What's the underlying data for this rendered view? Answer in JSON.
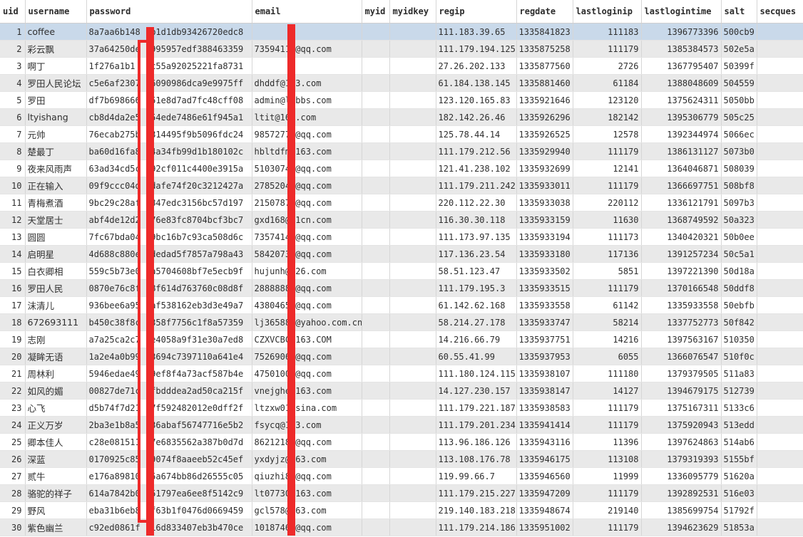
{
  "columns": [
    "uid",
    "username",
    "password",
    "email",
    "myid",
    "myidkey",
    "regip",
    "regdate",
    "lastloginip",
    "lastlogintime",
    "salt",
    "secques"
  ],
  "rows": [
    {
      "uid": "1",
      "username": "coffee",
      "password": "8a7aa6b148  b1d1db93426720edc8",
      "email": "",
      "myid": "",
      "myidkey": "",
      "regip": "111.183.39.65",
      "regdate": "1335841823",
      "lastloginip": "111183",
      "lastlogintime": "1396773396",
      "salt": "500cb9",
      "secques": ""
    },
    {
      "uid": "2",
      "username": "彩云飘",
      "password": "37a64250de  995957edf388463359",
      "email": "73594115@qq.com",
      "myid": "",
      "myidkey": "",
      "regip": "111.179.194.125",
      "regdate": "1335875258",
      "lastloginip": "111179",
      "lastlogintime": "1385384573",
      "salt": "502e5a",
      "secques": ""
    },
    {
      "uid": "3",
      "username": "啊丁",
      "password": "1f276a1b1   c55a92025221fa8731",
      "email": "",
      "myid": "",
      "myidkey": "",
      "regip": "27.26.202.133",
      "regdate": "1335877560",
      "lastloginip": "2726",
      "lastlogintime": "1367795407",
      "salt": "50399f",
      "secques": ""
    },
    {
      "uid": "4",
      "username": "罗田人民论坛",
      "password": "c5e6af2307  6090986dca9e9975ff",
      "email": "dhddf@163.com",
      "myid": "",
      "myidkey": "",
      "regip": "61.184.138.145",
      "regdate": "1335881460",
      "lastloginip": "61184",
      "lastlogintime": "1388048609",
      "salt": "504559",
      "secques": ""
    },
    {
      "uid": "5",
      "username": "罗田",
      "password": "df7b698666  51e8d7ad7fc48cff08",
      "email": "admin@lrbbs.com",
      "myid": "",
      "myidkey": "",
      "regip": "123.120.165.83",
      "regdate": "1335921646",
      "lastloginip": "123120",
      "lastlogintime": "1375624311",
      "salt": "5050bb",
      "secques": ""
    },
    {
      "uid": "6",
      "username": "ltyishang",
      "password": "cb8d4da2e5  54ede7486e61f945a1",
      "email": "ltit@163.com",
      "myid": "",
      "myidkey": "",
      "regip": "182.142.26.46",
      "regdate": "1335926296",
      "lastloginip": "182142",
      "lastlogintime": "1395306779",
      "salt": "505c25",
      "secques": ""
    },
    {
      "uid": "7",
      "username": "元帅",
      "password": "76ecab275b  314495f9b5096fdc24",
      "email": "98572776@qq.com",
      "myid": "",
      "myidkey": "",
      "regip": "125.78.44.14",
      "regdate": "1335926525",
      "lastloginip": "12578",
      "lastlogintime": "1392344974",
      "salt": "5066ec",
      "secques": ""
    },
    {
      "uid": "8",
      "username": "楚最丁",
      "password": "ba60d16fa8  4a34fb99d1b180102c",
      "email": "hbltdfm@163.com",
      "myid": "",
      "myidkey": "",
      "regip": "111.179.212.56",
      "regdate": "1335929940",
      "lastloginip": "111179",
      "lastlogintime": "1386131127",
      "salt": "5073b0",
      "secques": ""
    },
    {
      "uid": "9",
      "username": "夜来风雨声",
      "password": "63ad34cd5c  92cf011c4400e3915a",
      "email": "51030748@qq.com",
      "myid": "",
      "myidkey": "",
      "regip": "121.41.238.102",
      "regdate": "1335932699",
      "lastloginip": "12141",
      "lastlogintime": "1364046871",
      "salt": "508039",
      "secques": ""
    },
    {
      "uid": "10",
      "username": "正在输入",
      "password": "09f9ccc04d  dafe74f20c3212427a",
      "email": "27852045@qq.com",
      "myid": "",
      "myidkey": "",
      "regip": "111.179.211.242",
      "regdate": "1335933011",
      "lastloginip": "111179",
      "lastlogintime": "1366697751",
      "salt": "508bf8",
      "secques": ""
    },
    {
      "uid": "11",
      "username": "青梅煮酒",
      "password": "9bc29c28af  847edc3156bc57d197",
      "email": "21507874@qq.com",
      "myid": "",
      "myidkey": "",
      "regip": "220.112.22.30",
      "regdate": "1335933038",
      "lastloginip": "220112",
      "lastlogintime": "1336121791",
      "salt": "5097b3",
      "secques": ""
    },
    {
      "uid": "12",
      "username": "天堂居士",
      "password": "abf4de12d2  76e83fc8704bcf3bc7",
      "email": "gxd168@21cn.com",
      "myid": "",
      "myidkey": "",
      "regip": "116.30.30.118",
      "regdate": "1335933159",
      "lastloginip": "11630",
      "lastlogintime": "1368749592",
      "salt": "50a323",
      "secques": ""
    },
    {
      "uid": "13",
      "username": "圆圆",
      "password": "7fc67bda04  9bc16b7c93ca508d6c",
      "email": "73574145@qq.com",
      "myid": "",
      "myidkey": "",
      "regip": "111.173.97.135",
      "regdate": "1335933194",
      "lastloginip": "111173",
      "lastlogintime": "1340420321",
      "salt": "50b0ee",
      "secques": ""
    },
    {
      "uid": "14",
      "username": "启明星",
      "password": "4d688c880e  dedad5f7857a798a43",
      "email": "58420737@qq.com",
      "myid": "",
      "myidkey": "",
      "regip": "117.136.23.54",
      "regdate": "1335933180",
      "lastloginip": "117136",
      "lastlogintime": "1391257234",
      "salt": "50c5a1",
      "secques": ""
    },
    {
      "uid": "15",
      "username": "白衣卿相",
      "password": "559c5b73e0  a5704608bf7e5ecb9f",
      "email": "hujunh@126.com",
      "myid": "",
      "myidkey": "",
      "regip": "58.51.123.47",
      "regdate": "1335933502",
      "lastloginip": "5851",
      "lastlogintime": "1397221390",
      "salt": "50d18a",
      "secques": ""
    },
    {
      "uid": "16",
      "username": "罗田人民",
      "password": "0870e76c8f  8f614d763760c08d8f",
      "email": "28888888@qq.com",
      "myid": "",
      "myidkey": "",
      "regip": "111.179.195.3",
      "regdate": "1335933515",
      "lastloginip": "111179",
      "lastlogintime": "1370166548",
      "salt": "50ddf8",
      "secques": ""
    },
    {
      "uid": "17",
      "username": "沫清儿",
      "password": "936bee6a95  af538162eb3d3e49a7",
      "email": "43804650@qq.com",
      "myid": "",
      "myidkey": "",
      "regip": "61.142.62.168",
      "regdate": "1335933558",
      "lastloginip": "61142",
      "lastlogintime": "1335933558",
      "salt": "50ebfb",
      "secques": ""
    },
    {
      "uid": "18",
      "username": "672693111",
      "password": "b450c38f8c  358f7756c1f8a57359",
      "email": "lj365888@yahoo.com.cn",
      "myid": "",
      "myidkey": "",
      "regip": "58.214.27.178",
      "regdate": "1335933747",
      "lastloginip": "58214",
      "lastlogintime": "1337752773",
      "salt": "50f842",
      "secques": ""
    },
    {
      "uid": "19",
      "username": "志刚",
      "password": "a7a25ca2c7  e4058a9f31e30a7ed8",
      "email": "CZXVCBC@163.COM",
      "myid": "",
      "myidkey": "",
      "regip": "14.216.66.79",
      "regdate": "1335937751",
      "lastloginip": "14216",
      "lastlogintime": "1397563167",
      "salt": "510350",
      "secques": ""
    },
    {
      "uid": "20",
      "username": "凝眸无语",
      "password": "1a2e4a0b99  3694c7397110a641e4",
      "email": "75269066@qq.com",
      "myid": "",
      "myidkey": "",
      "regip": "60.55.41.99",
      "regdate": "1335937953",
      "lastloginip": "6055",
      "lastlogintime": "1366076547",
      "salt": "510f0c",
      "secques": ""
    },
    {
      "uid": "21",
      "username": "周林利",
      "password": "5946edae49  9ef8f4a73acf587b4e",
      "email": "47501004@qq.com",
      "myid": "",
      "myidkey": "",
      "regip": "111.180.124.115",
      "regdate": "1335938107",
      "lastloginip": "111180",
      "lastlogintime": "1379379505",
      "salt": "511a83",
      "secques": ""
    },
    {
      "uid": "22",
      "username": "如风的媚",
      "password": "00827de71c  fbdddea2ad50ca215f",
      "email": "vnejghe@163.com",
      "myid": "",
      "myidkey": "",
      "regip": "14.127.230.157",
      "regdate": "1335938147",
      "lastloginip": "14127",
      "lastlogintime": "1394679175",
      "salt": "512739",
      "secques": ""
    },
    {
      "uid": "23",
      "username": "心飞",
      "password": "d5b74f7d21  7f592482012e0dff2f",
      "email": "ltzxw01@sina.com",
      "myid": "",
      "myidkey": "",
      "regip": "111.179.221.187",
      "regdate": "1335938583",
      "lastloginip": "111179",
      "lastlogintime": "1375167311",
      "salt": "5133c6",
      "secques": ""
    },
    {
      "uid": "24",
      "username": "正义万岁",
      "password": "2ba3e1b8a5  36abaf56747716e5b2",
      "email": "fsycq@163.com",
      "myid": "",
      "myidkey": "",
      "regip": "111.179.201.234",
      "regdate": "1335941414",
      "lastloginip": "111179",
      "lastlogintime": "1375920943",
      "salt": "513edd",
      "secques": ""
    },
    {
      "uid": "25",
      "username": "卿本佳人",
      "password": "c28e081511  7e6835562a387b0d7d",
      "email": "86212188@qq.com",
      "myid": "",
      "myidkey": "",
      "regip": "113.96.186.126",
      "regdate": "1335943116",
      "lastloginip": "11396",
      "lastlogintime": "1397624863",
      "salt": "514ab6",
      "secques": ""
    },
    {
      "uid": "26",
      "username": "深蓝",
      "password": "0170925c85  9074f8aaeeb52c45ef",
      "email": "yxdyjz@163.com",
      "myid": "",
      "myidkey": "",
      "regip": "113.108.176.78",
      "regdate": "1335946175",
      "lastloginip": "113108",
      "lastlogintime": "1379319393",
      "salt": "5155bf",
      "secques": ""
    },
    {
      "uid": "27",
      "username": "贰牛",
      "password": "e176a89810  5a674bb86d26555c05",
      "email": "qiuzhi87@qq.com",
      "myid": "",
      "myidkey": "",
      "regip": "119.99.66.7",
      "regdate": "1335946560",
      "lastloginip": "11999",
      "lastlogintime": "1336095779",
      "salt": "51620a",
      "secques": ""
    },
    {
      "uid": "28",
      "username": "骆驼的祥子",
      "password": "614a7842b0  51797ea6ee8f5142c9",
      "email": "lt07730@163.com",
      "myid": "",
      "myidkey": "",
      "regip": "111.179.215.227",
      "regdate": "1335947209",
      "lastloginip": "111179",
      "lastlogintime": "1392892531",
      "salt": "516e03",
      "secques": ""
    },
    {
      "uid": "29",
      "username": "野风",
      "password": "eba31b6eb8  f63b1f0476d0669459",
      "email": "gcl578@163.com",
      "myid": "",
      "myidkey": "",
      "regip": "219.140.183.218",
      "regdate": "1335948674",
      "lastloginip": "219140",
      "lastlogintime": "1385699754",
      "salt": "51792f",
      "secques": ""
    },
    {
      "uid": "30",
      "username": "紫色幽兰",
      "password": "c92ed0861f  16d833407eb3b470ce",
      "email": "10187461@qq.com",
      "myid": "",
      "myidkey": "",
      "regip": "111.179.214.186",
      "regdate": "1335951002",
      "lastloginip": "111179",
      "lastlogintime": "1394623629",
      "salt": "51853a",
      "secques": ""
    }
  ],
  "redaction_color": "#ee2a2a",
  "selected_row_color": "#c9d9ea"
}
